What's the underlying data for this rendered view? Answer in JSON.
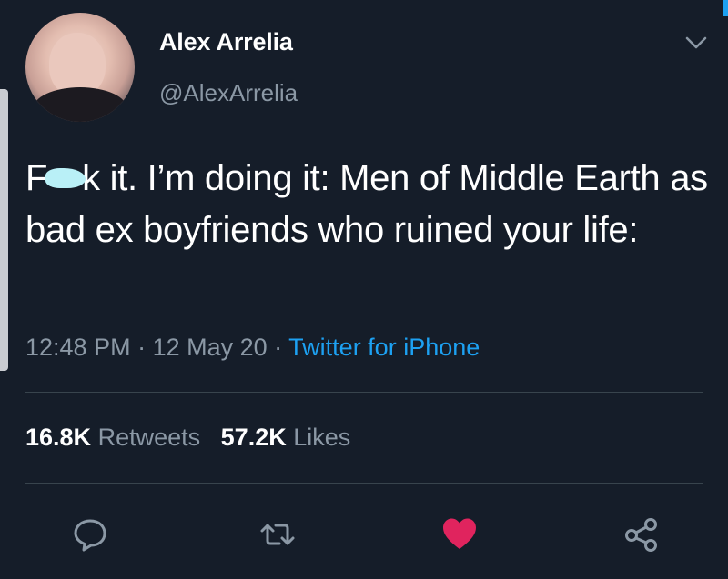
{
  "user": {
    "display_name": "Alex Arrelia",
    "handle": "@AlexArrelia"
  },
  "tweet": {
    "text_first_word_end": "k it. I’m doing it: Men of Middle Earth as bad ex boyfriends who ruined your life:",
    "text_first_letter": "F",
    "time": "12:48 PM",
    "date": "12 May 20",
    "separator": " · ",
    "source": "Twitter for iPhone"
  },
  "stats": {
    "retweets_count": "16.8K",
    "retweets_label": "Retweets",
    "likes_count": "57.2K",
    "likes_label": "Likes"
  },
  "actions": {
    "reply_icon": "comment-icon",
    "retweet_icon": "retweet-icon",
    "like_icon": "heart-icon",
    "share_icon": "share-icon",
    "liked": true
  },
  "colors": {
    "background": "#151d29",
    "link": "#1da1f2",
    "secondary_text": "#8b98a5",
    "like": "#e0245e"
  }
}
